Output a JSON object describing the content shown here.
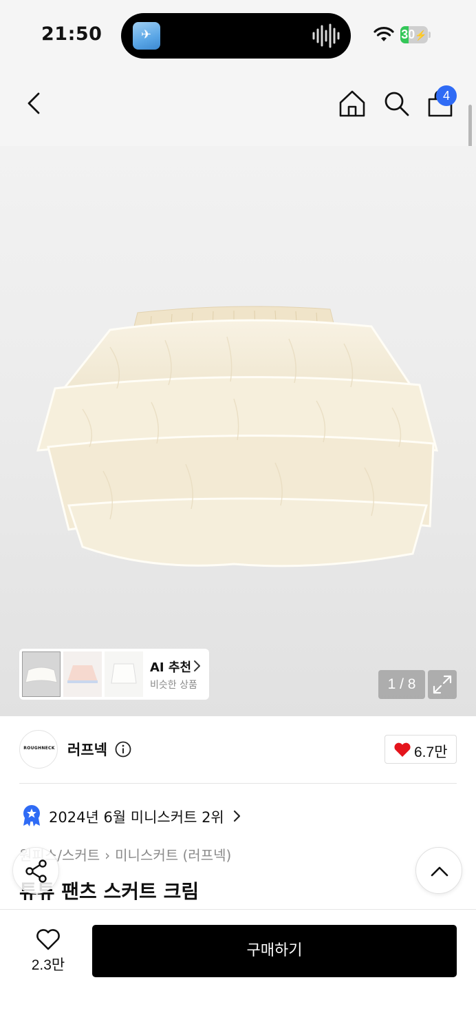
{
  "status_bar": {
    "time": "21:50",
    "battery_text": "30",
    "battery_level": 0.3,
    "battery_color": "#34c759"
  },
  "header": {
    "back_icon": "chevron-left-icon",
    "home_icon": "home-icon",
    "search_icon": "search-icon",
    "cart_icon": "shopping-bag-icon",
    "cart_badge": "4",
    "badge_color": "#2f6bf5"
  },
  "hero": {
    "ai_recommend": {
      "title": "AI 추천",
      "subtitle": "비슷한 상품"
    },
    "page_counter": "1 / 8",
    "current_image": 1,
    "total_images": 8
  },
  "brand": {
    "logo_text": "ROUGHNECK",
    "name": "러프넥",
    "like_count": "6.7만"
  },
  "ranking": {
    "text": "2024년 6월 미니스커트 2위"
  },
  "breadcrumb": {
    "items": [
      "원피스/스커트",
      "미니스커트 (러프넥)"
    ]
  },
  "product": {
    "title": "튜튜 팬츠 스커트 크림"
  },
  "bottom_bar": {
    "wish_count": "2.3만",
    "buy_label": "구매하기"
  }
}
